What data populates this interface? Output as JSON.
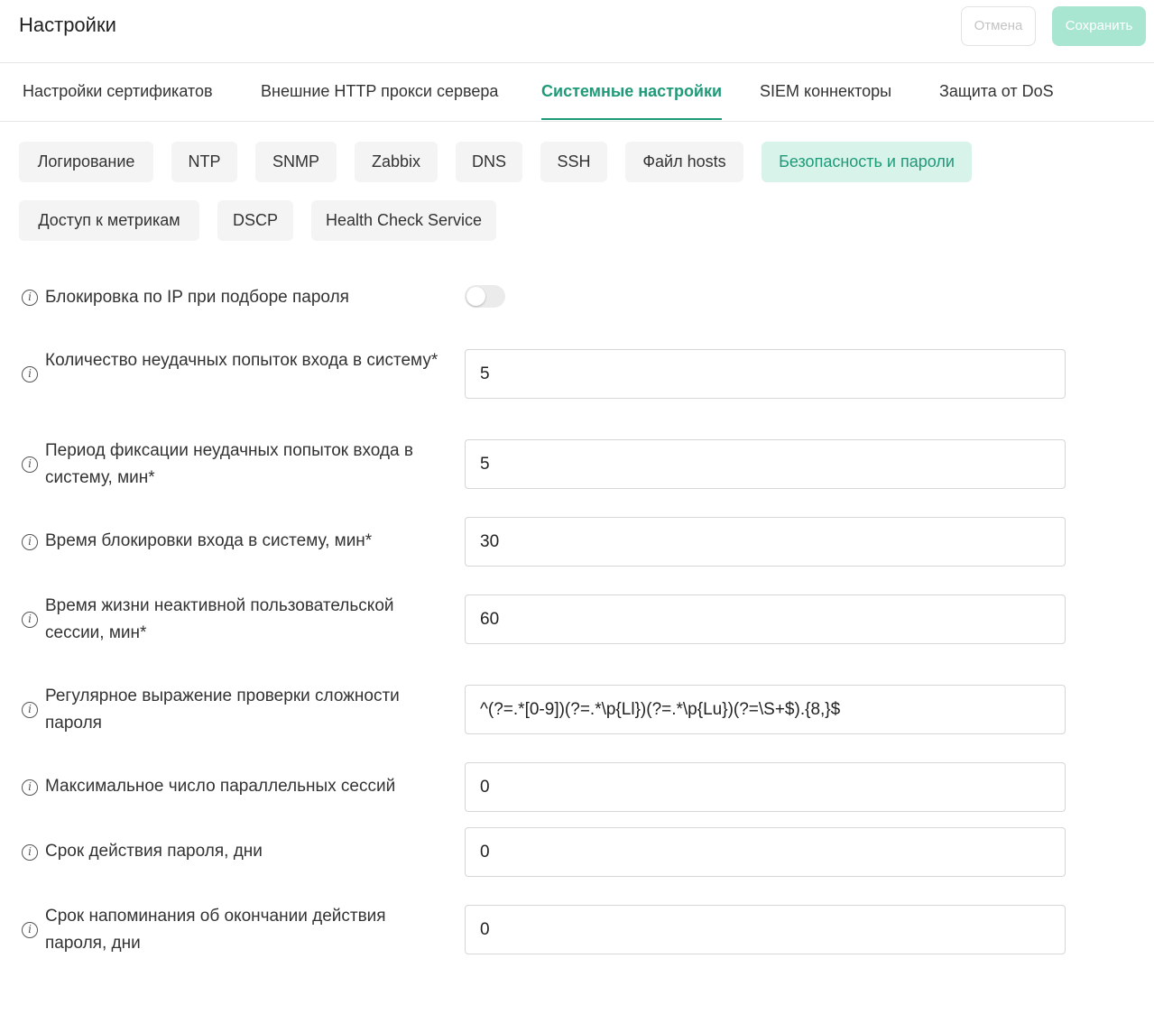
{
  "header": {
    "title": "Настройки",
    "cancel_label": "Отмена",
    "save_label": "Сохранить"
  },
  "tabs": [
    {
      "label": "Настройки сертификатов"
    },
    {
      "label": "Внешние HTTP прокси сервера"
    },
    {
      "label": "Системные настройки",
      "active": true
    },
    {
      "label": "SIEM коннекторы"
    },
    {
      "label": "Защита от DoS"
    }
  ],
  "subtabs": [
    {
      "label": "Логирование"
    },
    {
      "label": "NTP"
    },
    {
      "label": "SNMP"
    },
    {
      "label": "Zabbix"
    },
    {
      "label": "DNS"
    },
    {
      "label": "SSH"
    },
    {
      "label": "Файл hosts"
    },
    {
      "label": "Безопасность и пароли",
      "active": true
    },
    {
      "label": "Доступ к метрикам"
    },
    {
      "label": "DSCP"
    },
    {
      "label": "Health Check Service"
    }
  ],
  "settings": {
    "ip_block": {
      "label": "Блокировка по IP при подборе пароля",
      "enabled": false
    },
    "fields": [
      {
        "label": "Количество неудачных попыток входа в систему*",
        "value": "5"
      },
      {
        "label": "Период фиксации неудачных попыток входа в систему, мин*",
        "value": "5"
      },
      {
        "label": "Время блокировки входа в систему, мин*",
        "value": "30"
      },
      {
        "label": "Время жизни неактивной пользовательской сессии, мин*",
        "value": "60"
      },
      {
        "label": "Регулярное выражение проверки сложности пароля",
        "value": "^(?=.*[0-9])(?=.*\\p{Ll})(?=.*\\p{Lu})(?=\\S+$).{8,}$"
      },
      {
        "label": "Максимальное число параллельных сессий",
        "value": "0"
      },
      {
        "label": "Срок действия пароля, дни",
        "value": "0"
      },
      {
        "label": "Срок напоминания об окончании действия пароля, дни",
        "value": "0"
      }
    ]
  },
  "icons": {
    "info": "info-icon"
  },
  "colors": {
    "accent": "#1f9a78",
    "active_chip_bg": "#d8f3ea",
    "save_button_bg": "#a9e6d2"
  }
}
